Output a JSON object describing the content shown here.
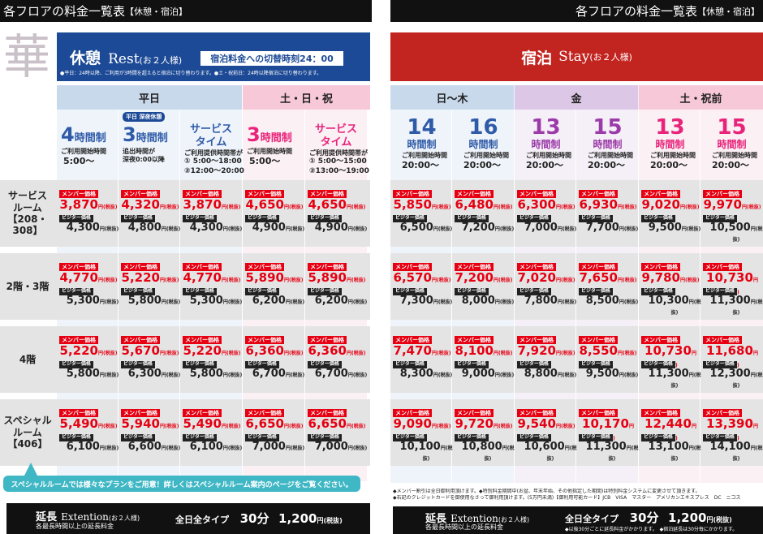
{
  "left": {
    "header": {
      "title": "各フロアの料金一覧表",
      "sub": "【休憩・宿泊】"
    },
    "logo_char": "華",
    "title_main": "休憩",
    "title_en": "Rest",
    "title_sub": "(お２人様)",
    "switch_box": "宿泊料金への切替時刻24：00",
    "note": "●平日：24時以降、ご利用が3時間を超えると宿泊に切り替わります。●土・祝前日：24時以降宿泊に切り替わります。",
    "groups": [
      {
        "label": "平日"
      },
      {
        "label": "土・日・祝"
      }
    ],
    "plans": [
      {
        "big": "4",
        "unit": "時間制",
        "l1": "ご利用開始時間",
        "l2": "5:00〜",
        "l3": ""
      },
      {
        "tag": "平日 深夜休憩",
        "big": "3",
        "unit": "時間制",
        "l1": "追出時間が",
        "l2": "深夜0:00以降",
        "l3": ""
      },
      {
        "big": "サービス",
        "unit": "タイム",
        "l1": "ご利用提供時間帯が",
        "l2": "① 5:00〜18:00",
        "l3": "②12:00〜20:00"
      },
      {
        "big": "3",
        "unit": "時間制",
        "l1": "ご利用開始時間",
        "l2": "5:00〜",
        "l3": ""
      },
      {
        "big": "サービス",
        "unit": "タイム",
        "l1": "ご利用提供時間帯が",
        "l2": "① 5:00〜15:00",
        "l3": "②13:00〜19:00"
      }
    ],
    "rows": [
      {
        "label": "サービス\nルーム\n【208・308】",
        "m": [
          "3,870",
          "4,320",
          "3,870",
          "4,650",
          "4,650"
        ],
        "v": [
          "4,300",
          "4,800",
          "4,300",
          "4,900",
          "4,900"
        ]
      },
      {
        "label": "2階・3階",
        "m": [
          "4,770",
          "5,220",
          "4,770",
          "5,890",
          "5,890"
        ],
        "v": [
          "5,300",
          "5,800",
          "5,300",
          "6,200",
          "6,200"
        ]
      },
      {
        "label": "4階",
        "m": [
          "5,220",
          "5,670",
          "5,220",
          "6,360",
          "6,360"
        ],
        "v": [
          "5,800",
          "6,300",
          "5,800",
          "6,700",
          "6,700"
        ]
      },
      {
        "label": "スペシャル\nルーム\n【406】",
        "m": [
          "5,490",
          "5,940",
          "5,490",
          "6,650",
          "6,650"
        ],
        "v": [
          "6,100",
          "6,600",
          "6,100",
          "7,000",
          "7,000"
        ]
      }
    ],
    "special_note": "スペシャルルームでは様々なプランをご用意！詳しくはスペシャルルーム案内のページをご覧ください。",
    "ext_title": "延長",
    "ext_en": "Extention",
    "ext_sub": "(お２人様)",
    "ext_note": "各最長時間以上の延長料金",
    "ext_type": "全日全タイプ",
    "ext_min": "30分",
    "ext_price": "1,200",
    "ext_unit": "円(税抜)"
  },
  "right": {
    "header": {
      "title": "各フロアの料金一覧表",
      "sub": "【休憩・宿泊】"
    },
    "title_main": "宿泊",
    "title_en": "Stay",
    "title_sub": "(お２人様)",
    "groups": [
      {
        "label": "日〜木"
      },
      {
        "label": "金"
      },
      {
        "label": "土・祝前"
      }
    ],
    "plans": [
      {
        "big": "14",
        "unit": "時間制",
        "l1": "ご利用開始時間",
        "l2": "20:00〜"
      },
      {
        "big": "16",
        "unit": "時間制",
        "l1": "ご利用開始時間",
        "l2": "20:00〜"
      },
      {
        "big": "13",
        "unit": "時間制",
        "l1": "ご利用開始時間",
        "l2": "20:00〜"
      },
      {
        "big": "15",
        "unit": "時間制",
        "l1": "ご利用開始時間",
        "l2": "20:00〜"
      },
      {
        "big": "13",
        "unit": "時間制",
        "l1": "ご利用開始時間",
        "l2": "20:00〜"
      },
      {
        "big": "15",
        "unit": "時間制",
        "l1": "ご利用開始時間",
        "l2": "20:00〜"
      }
    ],
    "rows": [
      {
        "m": [
          "5,850",
          "6,480",
          "6,300",
          "6,930",
          "9,020",
          "9,970"
        ],
        "v": [
          "6,500",
          "7,200",
          "7,000",
          "7,700",
          "9,500",
          "10,500"
        ]
      },
      {
        "m": [
          "6,570",
          "7,200",
          "7,020",
          "7,650",
          "9,780",
          "10,730"
        ],
        "v": [
          "7,300",
          "8,000",
          "7,800",
          "8,500",
          "10,300",
          "11,300"
        ]
      },
      {
        "m": [
          "7,470",
          "8,100",
          "7,920",
          "8,550",
          "10,730",
          "11,680"
        ],
        "v": [
          "8,300",
          "9,000",
          "8,800",
          "9,500",
          "11,300",
          "12,300"
        ]
      },
      {
        "m": [
          "9,090",
          "9,720",
          "9,540",
          "10,170",
          "12,440",
          "13,390"
        ],
        "v": [
          "10,100",
          "10,800",
          "10,600",
          "11,300",
          "13,100",
          "14,100"
        ]
      }
    ],
    "notes": [
      "◆メンバー割引は全日御利用頂けます。◆特別料金期間中(お盆、年末年始、その他指定した期間)は特別料金システムに変更させて頂きます。",
      "◆右記のクレジットカードを御使用なさって御利用頂けます。(5万円未満)【御利用可能カード】JCB　VISA　マスター　アメリカンエキスプレス　DC　ニコス"
    ],
    "ext_title": "延長",
    "ext_en": "Extention",
    "ext_sub": "(お２人様)",
    "ext_note": "各最長時間以上の延長料金",
    "ext_type": "全日全タイプ",
    "ext_min": "30分",
    "ext_price": "1,200",
    "ext_unit": "円(税抜)",
    "ext_fine": "◆以後30分ごとに延長料金がかかります。　◆宿泊延長は30分毎にかかります。"
  },
  "labels": {
    "member": "メンバー価格",
    "visitor": "ビジター価格",
    "yen": "円(税抜)"
  },
  "colors": {
    "blue": "#1d4a96",
    "red": "#c2241f",
    "member_red": "#e60012",
    "plan_blue": "#2e5aa8",
    "plan_pink": "#e8237a",
    "plan_purple": "#9b3aa8"
  }
}
